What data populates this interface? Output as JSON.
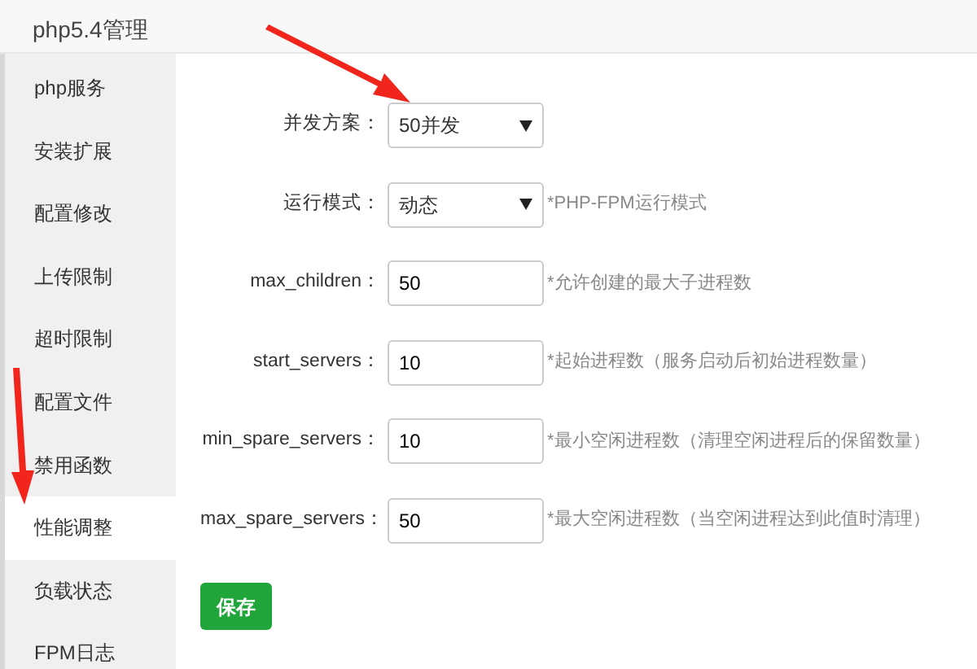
{
  "window": {
    "title": "php5.4管理"
  },
  "sidebar": {
    "items": [
      {
        "label": "php服务",
        "selected": false
      },
      {
        "label": "安装扩展",
        "selected": false
      },
      {
        "label": "配置修改",
        "selected": false
      },
      {
        "label": "上传限制",
        "selected": false
      },
      {
        "label": "超时限制",
        "selected": false
      },
      {
        "label": "配置文件",
        "selected": false
      },
      {
        "label": "禁用函数",
        "selected": false
      },
      {
        "label": "性能调整",
        "selected": true
      },
      {
        "label": "负载状态",
        "selected": false
      },
      {
        "label": "FPM日志",
        "selected": false
      }
    ]
  },
  "form": {
    "fields": [
      {
        "kind": "select",
        "label": "并发方案：",
        "value": "50并发"
      },
      {
        "kind": "select",
        "label": "运行模式：",
        "value": "动态",
        "hint": "*PHP-FPM运行模式"
      },
      {
        "kind": "input",
        "label": "max_children：",
        "value": "50",
        "hint": "*允许创建的最大子进程数"
      },
      {
        "kind": "input",
        "label": "start_servers：",
        "value": "10",
        "hint": "*起始进程数（服务启动后初始进程数量）"
      },
      {
        "kind": "input",
        "label": "min_spare_servers：",
        "value": "10",
        "hint": "*最小空闲进程数（清理空闲进程后的保留数量）"
      },
      {
        "kind": "input",
        "label": "max_spare_servers：",
        "value": "50",
        "hint": "*最大空闲进程数（当空闲进程达到此值时清理）"
      }
    ],
    "save_button": "保存"
  }
}
